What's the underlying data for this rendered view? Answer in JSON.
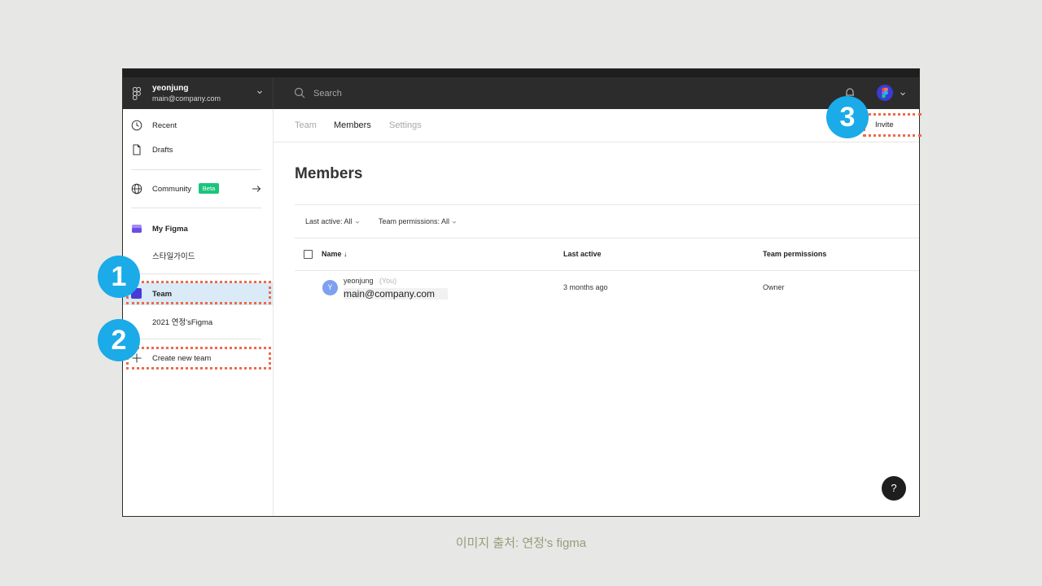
{
  "account": {
    "name": "yeonjung",
    "email": "main@company.com",
    "icon": "figma-logo-icon"
  },
  "search": {
    "placeholder": "Search"
  },
  "sidebar": {
    "recent": "Recent",
    "drafts": "Drafts",
    "community": "Community",
    "beta_badge": "Beta",
    "my_figma": "My Figma",
    "style_guide": "스타일가이드",
    "team": "Team",
    "team_2021": "2021 연정'sFigma",
    "create_team": "Create new team"
  },
  "tabs": [
    {
      "label": "Team",
      "active": false
    },
    {
      "label": "Members",
      "active": true
    },
    {
      "label": "Settings",
      "active": false
    }
  ],
  "invite_label": "Invite",
  "page_title": "Members",
  "filters": {
    "last_active": "Last active: All",
    "team_permissions": "Team permissions: All"
  },
  "table": {
    "headers": [
      "Name ↓",
      "Last active",
      "Team permissions"
    ],
    "rows": [
      {
        "avatar_letter": "Y",
        "name": "yeonjung",
        "you_tag": "(You)",
        "email": "main@company.com",
        "last_active": "3 months ago",
        "permission": "Owner"
      }
    ]
  },
  "help_label": "?",
  "annotations": {
    "marker_1": "1",
    "marker_2": "2",
    "marker_3": "3"
  },
  "caption": "이미지 출처: 연정's figma",
  "colors": {
    "topbar": "#2c2c2c",
    "selected_row": "#daebf7",
    "beta_green": "#1bc47d",
    "marker_blue": "#1aabe8",
    "annotation_dashes": "#ee6a4a"
  }
}
